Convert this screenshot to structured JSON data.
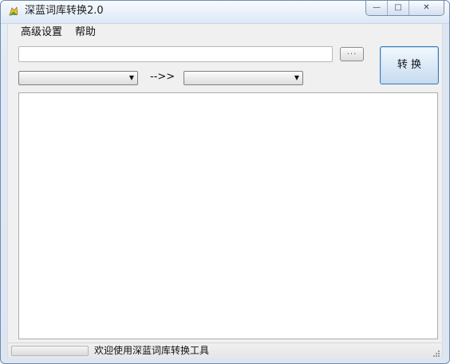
{
  "window": {
    "title": "深蓝词库转换2.0",
    "app_icon": "app-logo-icon",
    "controls": {
      "minimize_icon": "minimize-icon",
      "maximize_icon": "maximize-icon",
      "close_icon": "close-icon"
    }
  },
  "menu": {
    "items": [
      {
        "label": "高级设置"
      },
      {
        "label": "帮助"
      }
    ]
  },
  "toolbar": {
    "file_path_value": "",
    "browse_label": "...",
    "convert_label": "转 换"
  },
  "selects": {
    "source_value": "",
    "target_value": "",
    "arrow_label": "-->>"
  },
  "log": {
    "text": ""
  },
  "status": {
    "text": "欢迎使用深蓝词库转换工具",
    "progress_value": 0
  },
  "colors": {
    "window_border": "#6f8aa8",
    "window_background": "#dce6f3",
    "client_background": "#f0f0f0",
    "convert_border": "#3d7bb2"
  }
}
